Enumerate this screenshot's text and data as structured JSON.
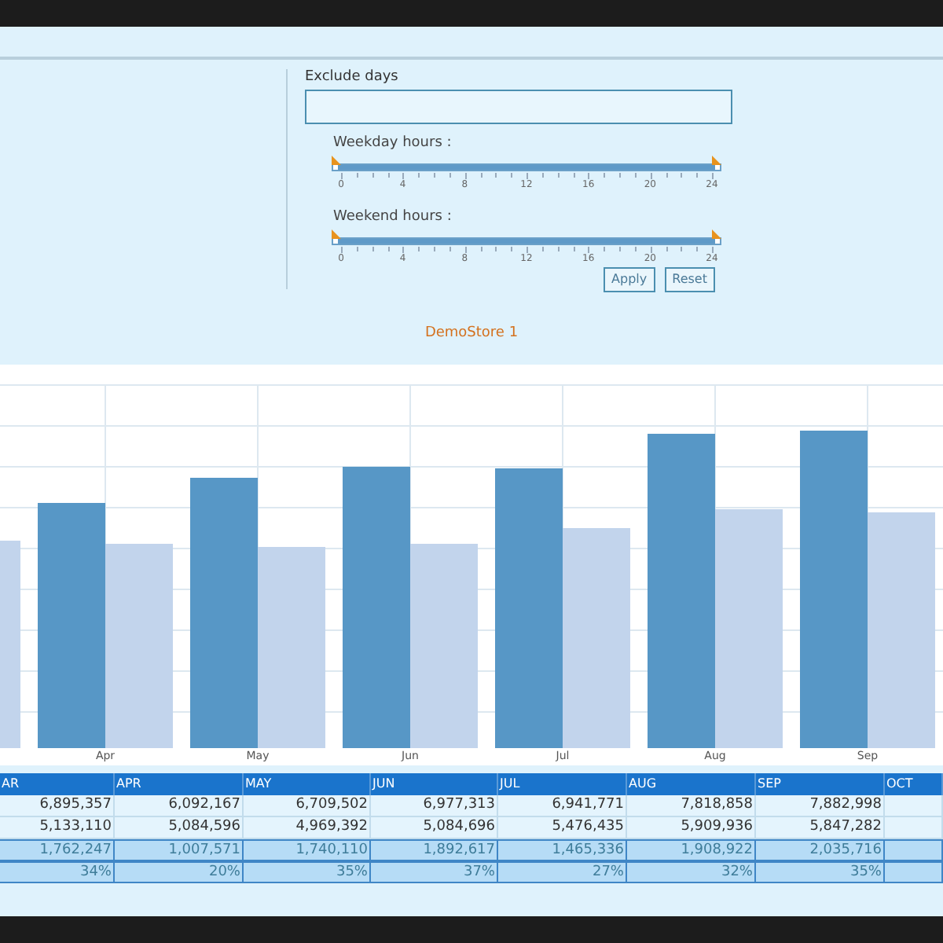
{
  "filters": {
    "exclude_days": {
      "label": "Exclude days"
    },
    "sliders": [
      {
        "label": "Weekday hours :",
        "level": 1,
        "ticks": [
          "0",
          "4",
          "8",
          "12",
          "16",
          "20",
          "24"
        ]
      },
      {
        "label": "Weekend hours :",
        "level": 1,
        "ticks": [
          "0",
          "4",
          "8",
          "12",
          "16",
          "20",
          "24"
        ]
      }
    ],
    "buttons": [
      "Apply",
      "Reset"
    ]
  },
  "chart": {
    "title": "DemoStore 1",
    "x_labels": [
      "Apr",
      "May",
      "Jun",
      "Jul",
      "Aug",
      "Sep"
    ]
  },
  "table": {
    "columns": [
      "AR",
      "APR",
      "MAY",
      "JUN",
      "JUL",
      "AUG",
      "SEP",
      "OCT"
    ],
    "rows": [
      {
        "kind": "plain",
        "cells": [
          "6,895,357",
          "6,092,167",
          "6,709,502",
          "6,977,313",
          "6,941,771",
          "7,818,858",
          "7,882,998"
        ]
      },
      {
        "kind": "plain",
        "cells": [
          "5,133,110",
          "5,084,596",
          "4,969,392",
          "5,084,696",
          "5,476,435",
          "5,909,936",
          "5,847,282"
        ]
      },
      {
        "kind": "summary",
        "cells": [
          "1,762,247",
          "1,007,571",
          "1,740,110",
          "1,892,617",
          "1,465,336",
          "1,908,922",
          "2,035,716"
        ]
      },
      {
        "kind": "summary",
        "cells": [
          "34%",
          "20%",
          "35%",
          "37%",
          "27%",
          "32%",
          "35%"
        ]
      }
    ]
  }
}
